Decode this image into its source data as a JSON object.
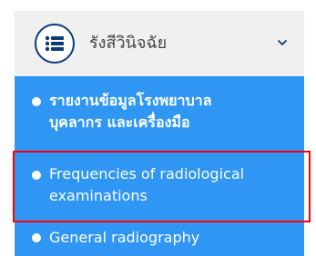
{
  "header": {
    "title": "รังสีวินิจฉัย",
    "menu_icon": "list-icon",
    "chevron_icon": "chevron-down-icon"
  },
  "menu": {
    "items": [
      {
        "lines": [
          "รายงานข้อมูลโรงพยาบาล",
          "บุคลากร และเครื่องมือ"
        ]
      },
      {
        "lines": [
          "Frequencies of radiological",
          "examinations"
        ]
      },
      {
        "lines": [
          "General radiography"
        ]
      }
    ]
  },
  "colors": {
    "header_background": "#f0f0f0",
    "header_text": "#444444",
    "icon_border": "#0b3a7a",
    "menu_background": "#2f96f3",
    "menu_text": "#ffffff",
    "highlight_border": "#ff0000"
  }
}
